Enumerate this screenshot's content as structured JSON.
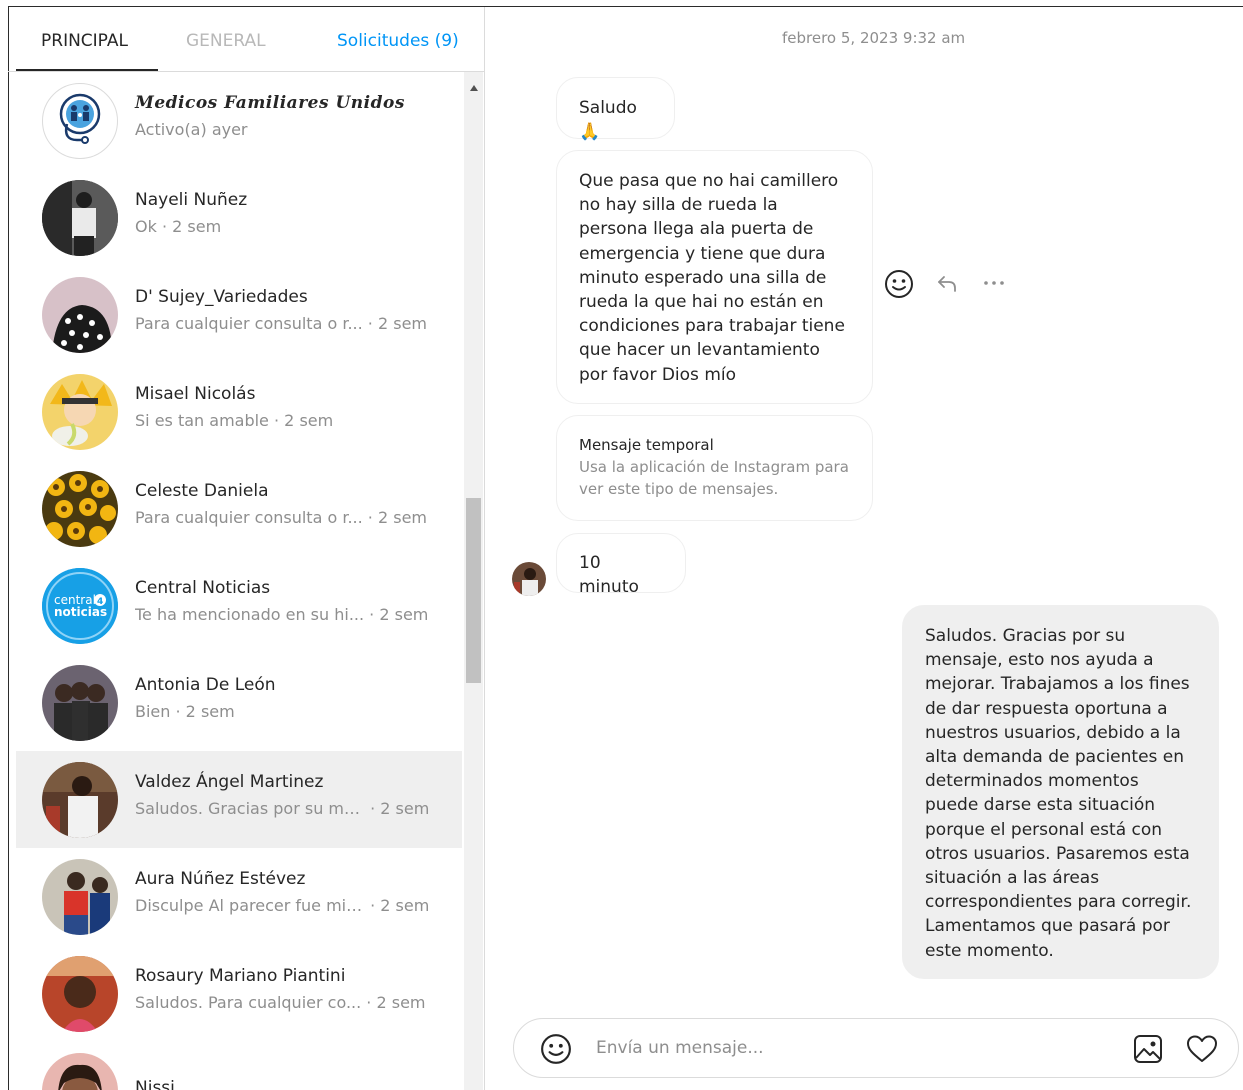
{
  "tabs": {
    "principal": "PRINCIPAL",
    "general": "GENERAL",
    "solicitudes": "Solicitudes (9)"
  },
  "conversations": [
    {
      "name": "Medicos Familiares Unidos",
      "preview": "Activo(a) ayer",
      "time": ""
    },
    {
      "name": "Nayeli Nuñez",
      "preview": "Ok",
      "time": "2 sem"
    },
    {
      "name": "D' Sujey_Variedades",
      "preview": "Para cualquier consulta o r...",
      "time": "2 sem"
    },
    {
      "name": "Misael Nicolás",
      "preview": "Si es tan amable",
      "time": "2 sem"
    },
    {
      "name": "Celeste Daniela",
      "preview": "Para cualquier consulta o r...",
      "time": "2 sem"
    },
    {
      "name": "Central Noticias",
      "preview": "Te ha mencionado en su hi...",
      "time": "2 sem"
    },
    {
      "name": "Antonia De León",
      "preview": "Bien",
      "time": "2 sem"
    },
    {
      "name": "Valdez Ángel Martinez",
      "preview": "Saludos. Gracias por su me...",
      "time": "2 sem"
    },
    {
      "name": "Aura Núñez Estévez",
      "preview": "Disculpe Al parecer fue mi ...",
      "time": "2 sem"
    },
    {
      "name": "Rosaury Mariano Piantini",
      "preview": "Saludos. Para cualquier co...",
      "time": "2 sem"
    },
    {
      "name": "Nissi",
      "preview": "",
      "time": ""
    }
  ],
  "separator": " · ",
  "avatar_logo_text": {
    "line1": "central",
    "line2": "noticias",
    "badge": "4"
  },
  "chat": {
    "timestamp": "febrero 5, 2023 9:32 am",
    "messages": {
      "m1": "Saludo 🙏",
      "m2": "Que pasa que no hai camillero no hay silla de rueda la persona llega ala puerta de emergencia y tiene que dura minuto esperado una silla de rueda la que hai no están en condiciones para trabajar tiene que hacer un levantamiento por favor Dios mío",
      "m3_title": "Mensaje temporal",
      "m3_sub": "Usa la aplicación de Instagram para ver este tipo de mensajes.",
      "m4": "10 minuto",
      "m5": "Saludos. Gracias por su mensaje, esto nos ayuda a mejorar. Trabajamos a los fines de dar respuesta oportuna a nuestros usuarios, debido a la alta demanda de pacientes en determinados momentos puede darse esta situación porque el personal está con otros usuarios. Pasaremos esta situación a las áreas correspondientes para corregir. Lamentamos que pasará por este momento."
    },
    "composer_placeholder": "Envía un mensaje..."
  },
  "colors": {
    "accent": "#0095f6",
    "muted": "#8e8e8e",
    "text": "#262626",
    "active_row": "#efefef"
  },
  "icons": [
    "emoji-icon",
    "reply-icon",
    "more-icon",
    "image-icon",
    "heart-icon"
  ]
}
